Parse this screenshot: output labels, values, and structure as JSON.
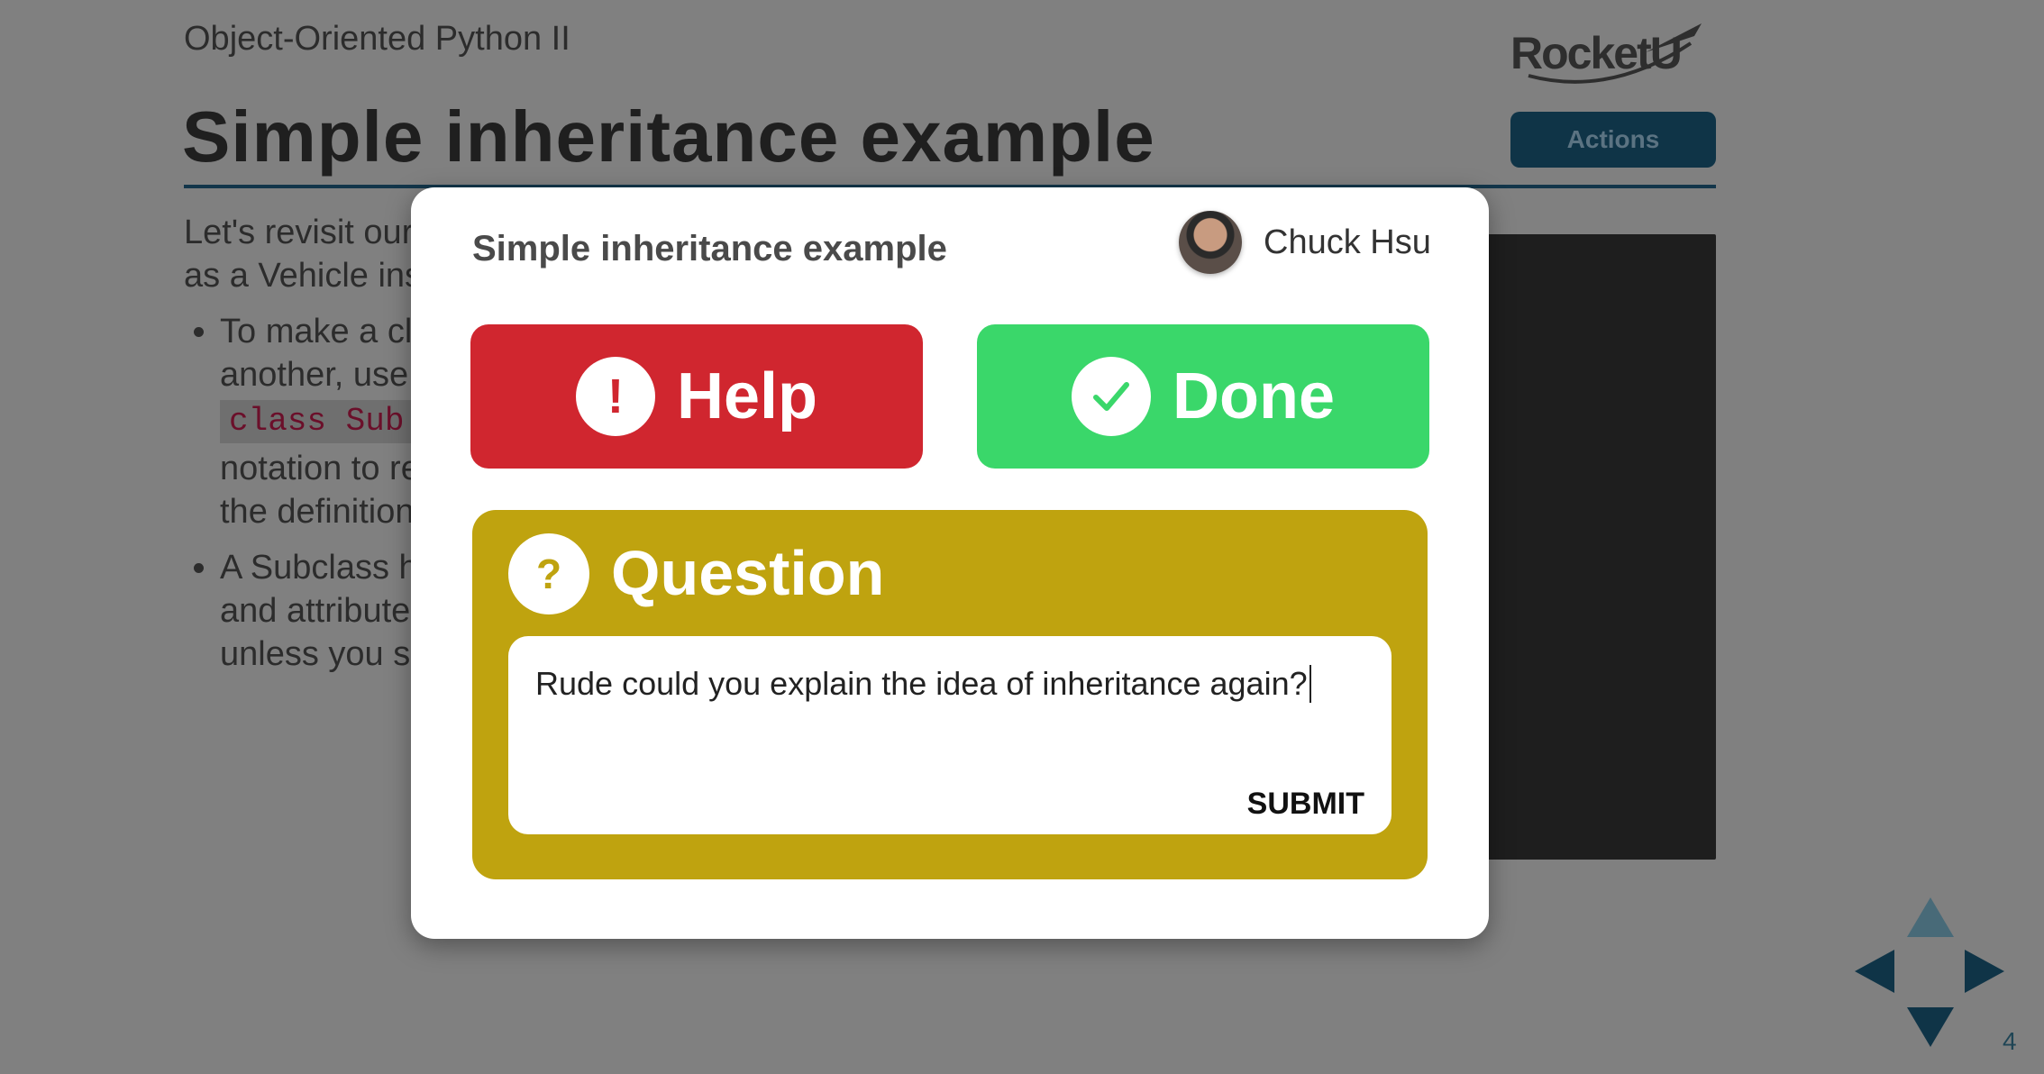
{
  "slide": {
    "deck_subtitle": "Object-Oriented Python II",
    "logo_text": "RocketU",
    "title": "Simple inheritance example",
    "actions_label": "Actions",
    "intro_lines": [
      "Let's revisit our",
      "as a Vehicle ins"
    ],
    "bullets": [
      {
        "lines": [
          "To make a cl",
          "another, use"
        ],
        "code": "class Sub",
        "after": [
          "notation to re",
          "the definition"
        ]
      },
      {
        "lines": [
          "A Subclass h",
          "and attribute",
          "unless you sp"
        ]
      }
    ],
    "page_number": "4"
  },
  "modal": {
    "title": "Simple inheritance example",
    "user_name": "Chuck Hsu",
    "help_label": "Help",
    "help_icon_glyph": "!",
    "done_label": "Done",
    "question_icon_glyph": "?",
    "question_label": "Question",
    "question_text": "Rude could you explain the idea of inheritance again?",
    "submit_label": "SUBMIT"
  },
  "colors": {
    "help": "#d0262f",
    "done": "#3ad76a",
    "question": "#bfa30f",
    "brand_dark": "#0f3447"
  }
}
